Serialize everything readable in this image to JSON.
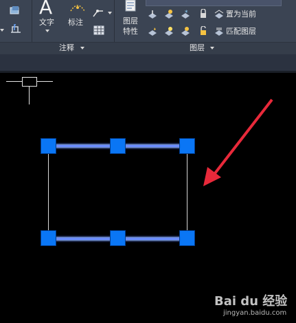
{
  "ribbon": {
    "annotation_panel": {
      "text_label": "文字",
      "text_icon": "A",
      "dimension_label": "标注",
      "footer_label": "注释"
    },
    "layers_panel": {
      "layer_properties_label_line1": "图层",
      "layer_properties_label_line2": "特性",
      "set_current_label": "置为当前",
      "match_layer_label": "匹配图层",
      "footer_label": "图层"
    }
  },
  "watermark": {
    "brand": "Bai du 经验",
    "url": "jingyan.baidu.com"
  },
  "colors": {
    "ribbon_bg": "#3b4453",
    "canvas_bg": "#000000",
    "grip": "#0a76f5",
    "arrow": "#e8293a",
    "selected_edge": "#6a8cff"
  }
}
